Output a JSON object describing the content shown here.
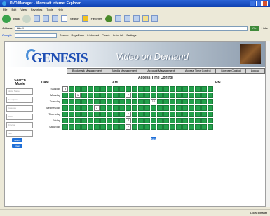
{
  "window": {
    "title": "DVD Manager - Microsoft Internet Explorer"
  },
  "menu": {
    "items": [
      "File",
      "Edit",
      "View",
      "Favorites",
      "Tools",
      "Help"
    ]
  },
  "toolbar": {
    "back_label": "Back",
    "search_label": "Search",
    "favorites_label": "Favorites"
  },
  "address": {
    "label": "Address",
    "value": "http://",
    "go_label": "Go",
    "links_label": "Links"
  },
  "google": {
    "label": "Google",
    "search_label": "Search",
    "pagerank_label": "PageRank",
    "blocked_label": "0 blocked",
    "check_label": "Check",
    "autolink_label": "AutoLink",
    "settings_label": "Settings"
  },
  "header": {
    "logo": "GENESIS",
    "tagline": "Video on Demand"
  },
  "nav": {
    "items": [
      "Bookmark Management",
      "Media Management",
      "Account Management",
      "Access Time Control",
      "License Control",
      "Logout"
    ]
  },
  "sidebar": {
    "search_title": "Search",
    "movie_title": "Movie",
    "fields": [
      "Movie Name",
      "Description",
      "Category",
      "Actor",
      "Director",
      "Year"
    ],
    "search_button": "Search",
    "clear_button": "Clear"
  },
  "schedule": {
    "title": "Access Time Control",
    "date_label": "Date",
    "am_label": "AM",
    "pm_label": "PM",
    "days": [
      "Sunday",
      "Monday",
      "Tuesday",
      "Wednesday",
      "Thursday",
      "Friday",
      "Saturday"
    ],
    "hours_per_day": 24,
    "unlocked_cells": [
      {
        "day": 0,
        "hour": 0,
        "label": "0"
      },
      {
        "day": 1,
        "hour": 2,
        "label": "1"
      },
      {
        "day": 1,
        "hour": 10,
        "label": "7"
      },
      {
        "day": 2,
        "hour": 14,
        "label": "10"
      },
      {
        "day": 3,
        "hour": 5,
        "label": "3"
      },
      {
        "day": 4,
        "hour": 10,
        "label": "7"
      },
      {
        "day": 5,
        "hour": 10,
        "label": "7"
      },
      {
        "day": 6,
        "hour": 10,
        "label": "7"
      }
    ],
    "save_label": "Save"
  },
  "status": {
    "left": "",
    "right": "Local intranet"
  },
  "colors": {
    "grid_locked": "#22a04b",
    "grid_unlocked": "#ffffff",
    "accent": "#1e6fd8"
  }
}
